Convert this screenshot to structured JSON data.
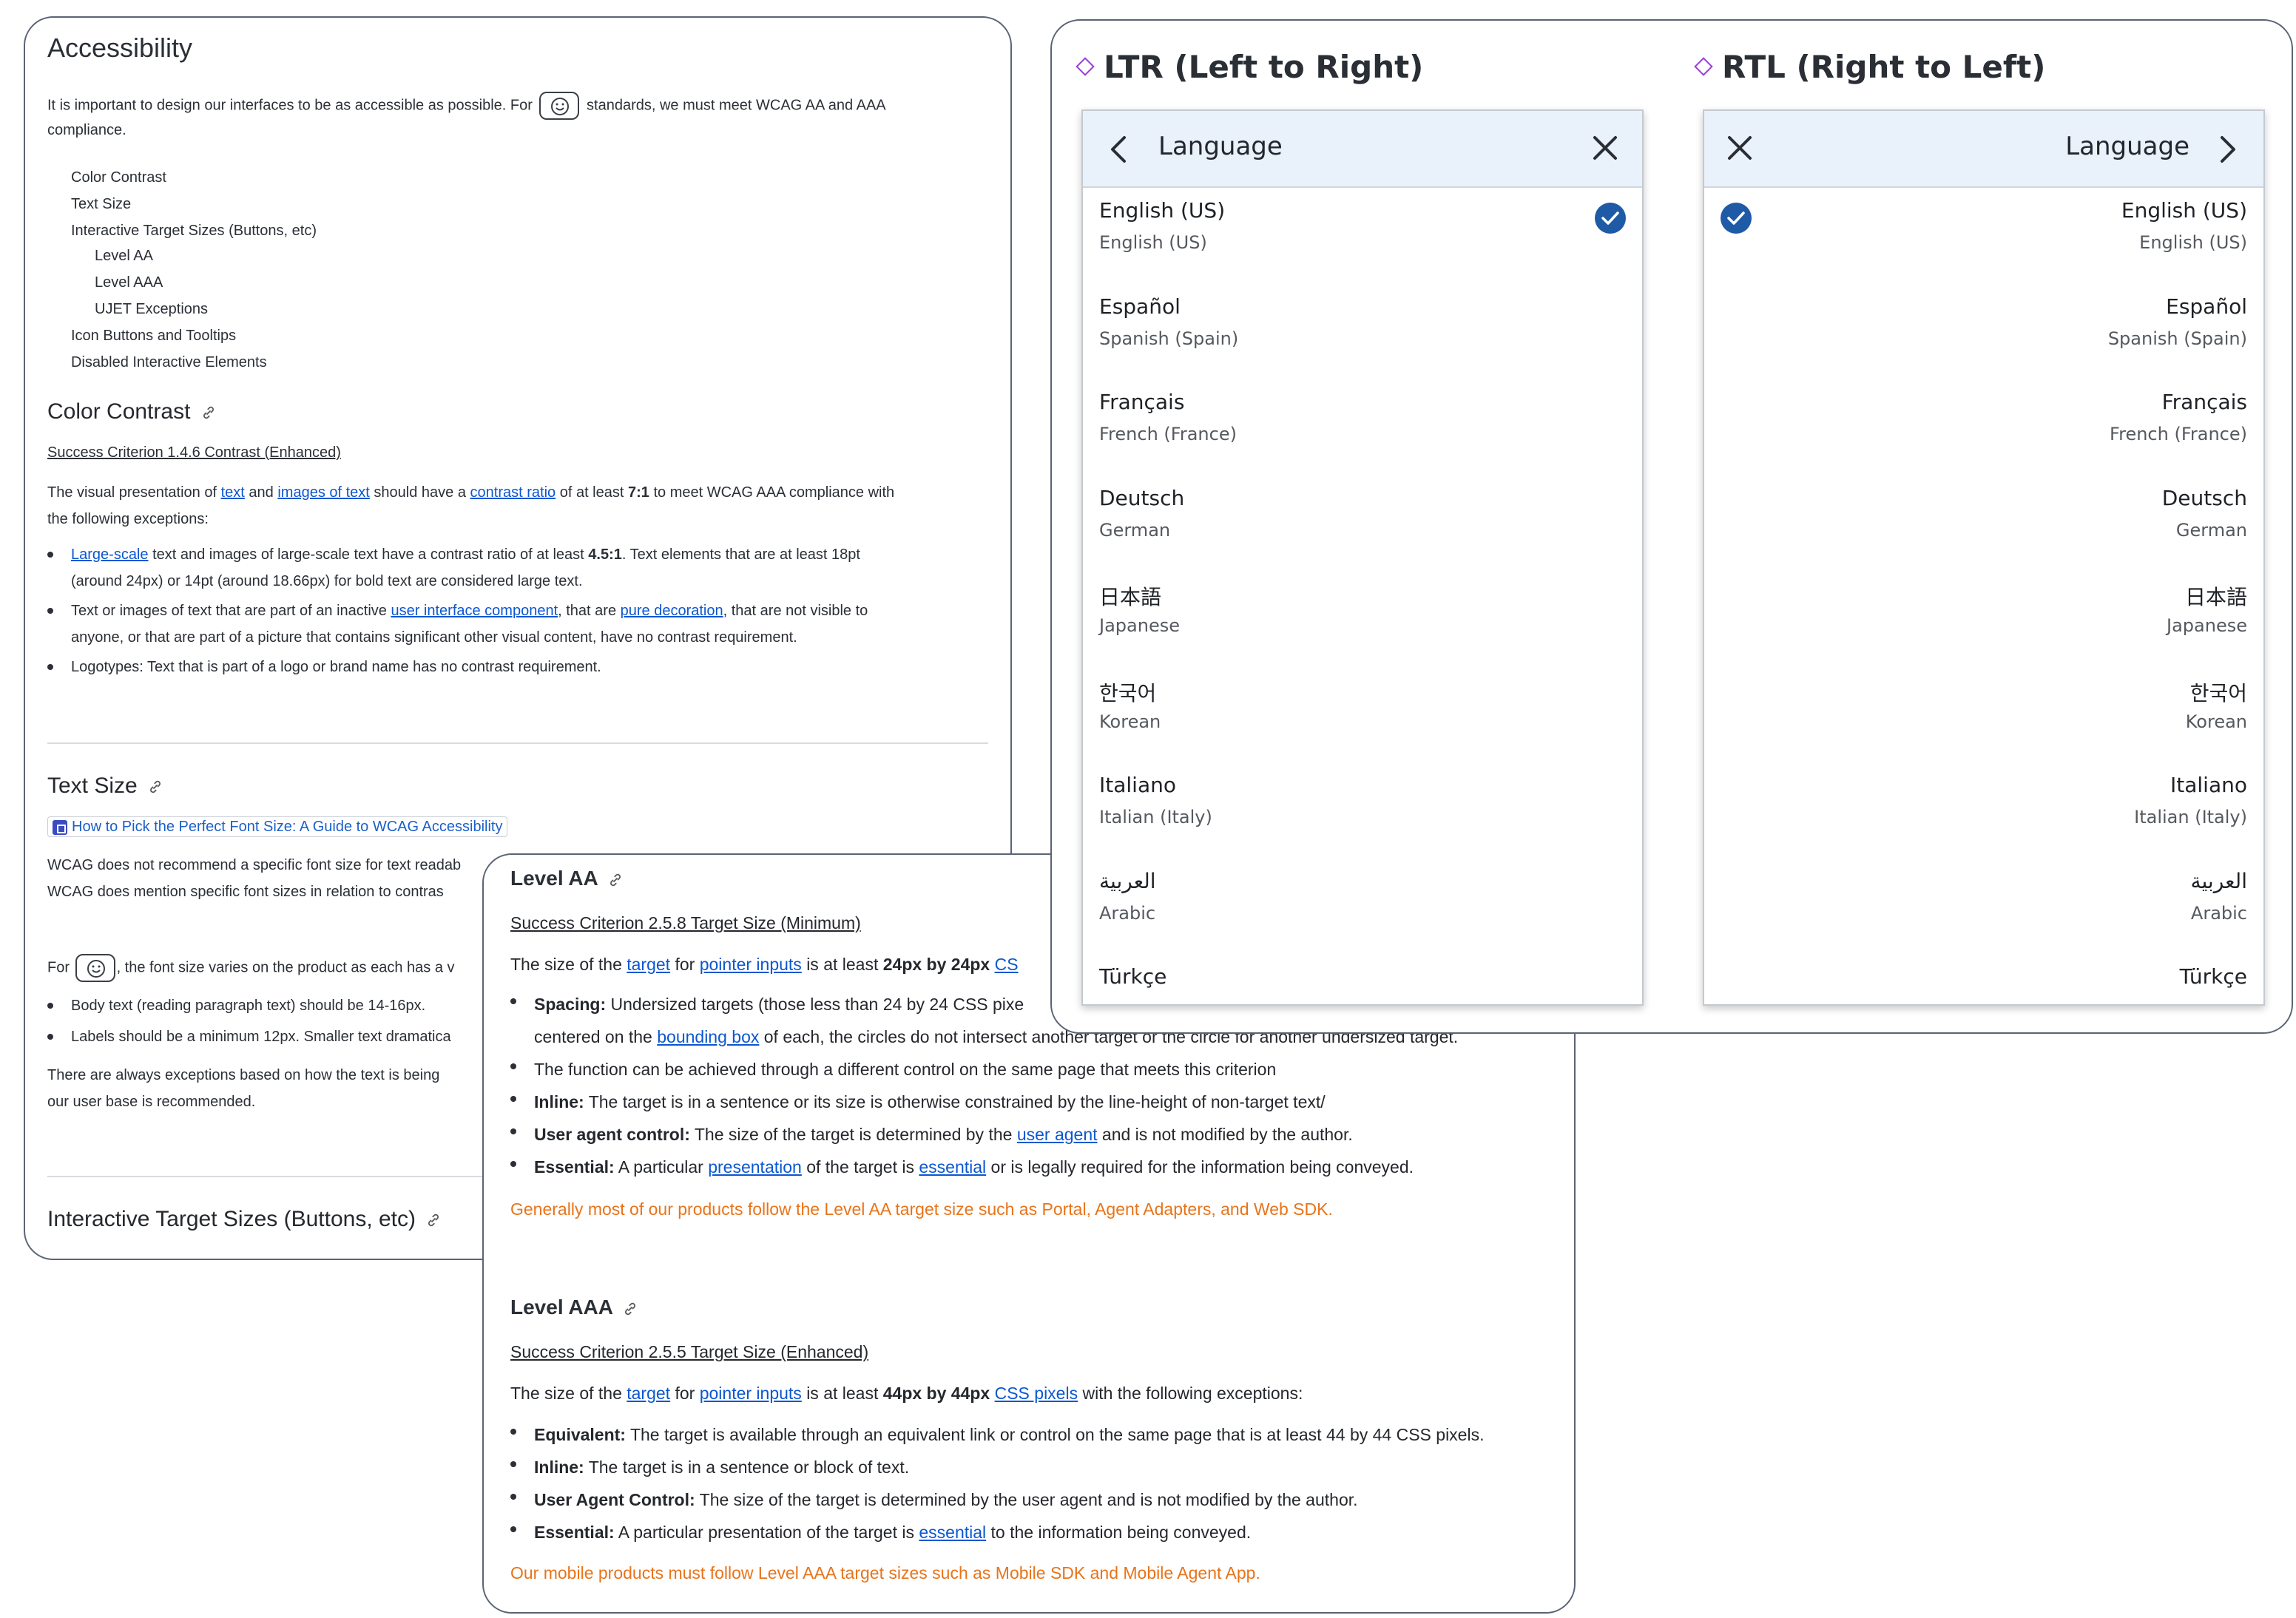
{
  "doc": {
    "title": "Accessibility",
    "intro_1": "It is important to design our interfaces to be as accessible as possible. For",
    "intro_2": "standards, we must meet WCAG AA and AAA",
    "intro_3": "compliance.",
    "toc": [
      "Color Contrast",
      "Text Size",
      "Interactive Target Sizes (Buttons, etc)",
      "Level AA",
      "Level AAA",
      "UJET Exceptions",
      "Icon Buttons and Tooltips",
      "Disabled Interactive Elements"
    ],
    "color_contrast": {
      "heading": "Color Contrast",
      "link": "Success Criterion 1.4.6 Contrast (Enhanced)",
      "p1_a": "The visual presentation of",
      "p1_text": "text",
      "p1_b": "and",
      "p1_images": "images of text",
      "p1_c": "should have a",
      "p1_ratio": "contrast ratio",
      "p1_d": "of at least",
      "p1_num": "7:1",
      "p1_e": "to meet WCAG AAA compliance with",
      "p1_f": "the following exceptions:",
      "b1_link": "Large-scale",
      "b1_a": "text and images of large-scale text have a contrast ratio of at least",
      "b1_num": "4.5:1",
      "b1_b": ". Text elements that are at least 18pt",
      "b1_c": "(around 24px) or 14pt (around 18.66px) for bold text are considered large text.",
      "b2_a": "Text or images of text that are part of an inactive",
      "b2_link1": "user interface component",
      "b2_b": ", that are",
      "b2_link2": "pure decoration",
      "b2_c": ", that are not visible to",
      "b2_d": "anyone, or that are part of a picture that contains significant other visual content, have no contrast requirement.",
      "b3": "Logotypes: Text that is part of a logo or brand name has no contrast requirement."
    },
    "text_size": {
      "heading": "Text Size",
      "ext_link": "How to Pick the Perfect Font Size: A Guide to WCAG Accessibility",
      "p1": "WCAG does not recommend a specific font size for text readab",
      "p2": "WCAG does mention specific font sizes in relation to contras",
      "p3_a": "For",
      "p3_b": ", the font size varies on the product as each has a v",
      "b1": "Body text (reading paragraph text) should be 14-16px.",
      "b2": "Labels should be a minimum 12px. Smaller text dramatica",
      "p4": "There are always exceptions based on how the text is being",
      "p5": "our user base is recommended."
    },
    "interactive_heading": "Interactive Target Sizes (Buttons, etc)"
  },
  "level": {
    "aa": {
      "heading": "Level AA",
      "link": "Success Criterion 2.5.8 Target Size (Minimum)",
      "p_a": "The size of the",
      "p_target": "target",
      "p_b": "for",
      "p_pointer": "pointer inputs",
      "p_c": "is at least",
      "p_size": "24px by 24px",
      "p_css": "CS",
      "b1_label": "Spacing:",
      "b1_a": "Undersized targets (those less than 24 by 24 CSS pixe",
      "b1_b": "centered on the",
      "b1_link": "bounding box",
      "b1_c": "of each, the circles do not intersect another target or the circle for another undersized target.",
      "b2": "The function can be achieved through a different control on the same page that meets this criterion",
      "b3_label": "Inline:",
      "b3": "The target is in a sentence or its size is otherwise constrained by the line-height of non-target text/",
      "b4_label": "User agent control:",
      "b4_a": "The size of the target is determined by the",
      "b4_link": "user agent",
      "b4_b": "and is not modified by the author.",
      "b5_label": "Essential:",
      "b5_a": "A particular",
      "b5_link1": "presentation",
      "b5_b": "of the target is",
      "b5_link2": "essential",
      "b5_c": "or is legally required for the information being conveyed.",
      "note": "Generally most of our products follow the Level AA target size such as Portal, Agent Adapters, and Web SDK."
    },
    "aaa": {
      "heading": "Level AAA",
      "link": "Success Criterion 2.5.5 Target Size (Enhanced)",
      "p_a": "The size of the",
      "p_target": "target",
      "p_b": "for",
      "p_pointer": "pointer inputs",
      "p_c": "is at least",
      "p_size": "44px by 44px",
      "p_css": "CSS pixels",
      "p_d": "with the following exceptions:",
      "b1_label": "Equivalent:",
      "b1": "The target is available through an equivalent link or control on the same page that is at least 44 by 44 CSS pixels.",
      "b2_label": "Inline:",
      "b2": "The target is in a sentence or block of text.",
      "b3_label": "User Agent Control:",
      "b3": "The size of the target is determined by the user agent and is not modified by the author.",
      "b4_label": "Essential:",
      "b4_a": "A particular presentation of the target is",
      "b4_link": "essential",
      "b4_b": "to the information being conveyed.",
      "note": "Our mobile products must follow Level AAA target sizes such as Mobile SDK and Mobile Agent App."
    }
  },
  "lang": {
    "ltr_heading": "LTR (Left to Right)",
    "rtl_heading": "RTL (Right to Left)",
    "panel_title": "Language",
    "items": [
      {
        "primary": "English (US)",
        "secondary": "English (US)"
      },
      {
        "primary": "Español",
        "secondary": "Spanish (Spain)"
      },
      {
        "primary": "Français",
        "secondary": "French (France)"
      },
      {
        "primary": "Deutsch",
        "secondary": "German"
      },
      {
        "primary": "日本語",
        "secondary": "Japanese"
      },
      {
        "primary": "한국어",
        "secondary": "Korean"
      },
      {
        "primary": "Italiano",
        "secondary": "Italian (Italy)"
      },
      {
        "primary": "العربية",
        "secondary": "Arabic"
      },
      {
        "primary": "Türkçe",
        "secondary": ""
      }
    ]
  },
  "colors": {
    "link": "#0b57d0",
    "orange_note": "#e8741a",
    "panel_header": "#e9f1fb",
    "check": "#1f5aa6",
    "diamond": "#9b3fd6"
  }
}
